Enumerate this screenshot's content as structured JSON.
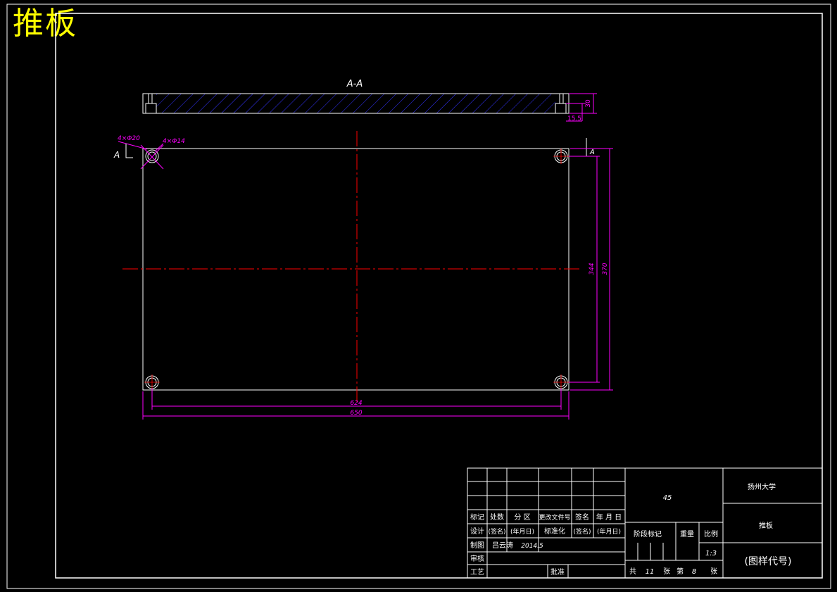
{
  "title": "推板",
  "colors": {
    "border": "#ffffff",
    "geometry": "#ffffff",
    "dimension": "#ff00ff",
    "centerline": "#ff0000",
    "hatch": "#3333ff",
    "title_text": "#ffff00"
  },
  "section": {
    "label": "A-A",
    "dims": {
      "thickness": "30",
      "step": "15.5"
    }
  },
  "plan": {
    "hole_outer": "4×Φ20",
    "hole_inner": "4×Φ14",
    "section_mark": "A",
    "dims": {
      "width_holes": "624",
      "width_total": "650",
      "height_holes": "344",
      "height_total": "370"
    }
  },
  "title_block": {
    "material": "45",
    "school": "扬州大学",
    "part_name": "推板",
    "drawing_no": "(图样代号)",
    "header_row": [
      "标记",
      "处数",
      "分  区",
      "更改文件号",
      "签名",
      "年 月 日"
    ],
    "design_row": [
      "设计",
      "(签名)",
      "(年月日)",
      "标准化",
      "(签名)",
      "(年月日)"
    ],
    "draw_label": "制图",
    "draw_name": "吕云涛",
    "draw_date": "2014.5",
    "check_label": "审核",
    "process_label": "工艺",
    "approve_label": "批准",
    "stage_label": "阶段标记",
    "weight_label": "重量",
    "scale_label": "比例",
    "scale_value": "1:3",
    "sheet_total_prefix": "共",
    "sheet_total": "11",
    "sheet_total_suffix": "张",
    "sheet_no_prefix": "第",
    "sheet_no": "8",
    "sheet_no_suffix": "张"
  }
}
